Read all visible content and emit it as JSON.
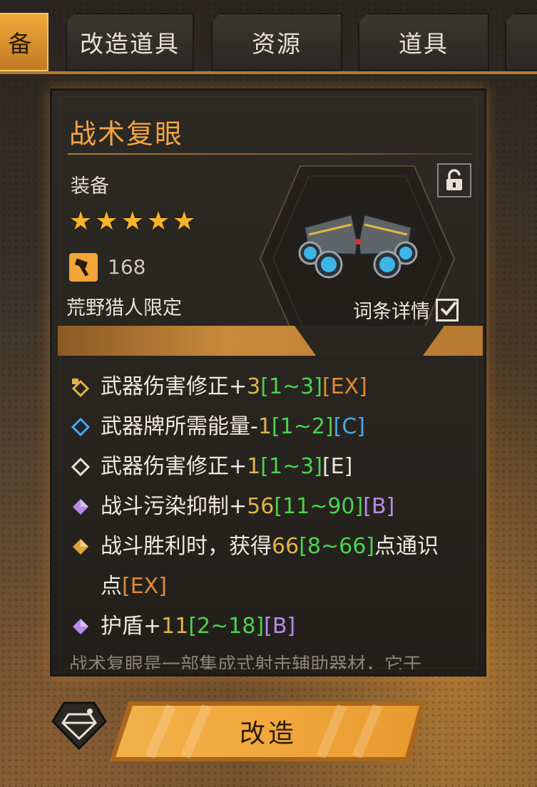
{
  "tabs": [
    {
      "label": "备",
      "active": true
    },
    {
      "label": "改造道具",
      "active": false
    },
    {
      "label": "资源",
      "active": false
    },
    {
      "label": "道具",
      "active": false
    },
    {
      "label": "",
      "active": false
    }
  ],
  "item": {
    "name": "战术复眼",
    "category": "装备",
    "stars": 5,
    "power": "168",
    "exclusive": "荒野猎人限定",
    "details_label": "词条详情",
    "details_checked": true,
    "lock_icon": "unlock-icon"
  },
  "stats": [
    {
      "gem": "gold-lock",
      "gem_color": "#e0b34a",
      "name": "武器伤害修正",
      "sign": "+",
      "value": "3",
      "range": "[1~3]",
      "grade": "[EX]",
      "grade_class": "ex"
    },
    {
      "gem": "diamond",
      "gem_color": "#4aa7e6",
      "name": "武器牌所需能量",
      "sign": "-",
      "value": "1",
      "range": "[1~2]",
      "grade": "[C]",
      "grade_class": "c"
    },
    {
      "gem": "diamond",
      "gem_color": "#e9e2d7",
      "name": "武器伤害修正",
      "sign": "+",
      "value": "1",
      "range": "[1~3]",
      "grade": "[E]",
      "grade_class": "e"
    },
    {
      "gem": "diamond",
      "gem_color": "#b58be6",
      "name": "战斗污染抑制",
      "sign": "+",
      "value": "56",
      "range": "[11~90]",
      "grade": "[B]",
      "grade_class": "b"
    },
    {
      "gem": "diamond",
      "gem_color": "#e0a23a",
      "name": "战斗胜利时，获得",
      "sign": "",
      "value": "66",
      "range": "[8~66]",
      "suffix_line1": "点通识",
      "suffix_line2": "点",
      "grade": "[EX]",
      "grade_class": "ex"
    },
    {
      "gem": "diamond",
      "gem_color": "#b58be6",
      "name": "护盾",
      "sign": "+",
      "value": "11",
      "range": "[2~18]",
      "grade": "[B]",
      "grade_class": "b"
    }
  ],
  "flavor": "战术复眼是一部集成式射击辅助器材，它于",
  "buttons": {
    "modify_label": "改造"
  }
}
